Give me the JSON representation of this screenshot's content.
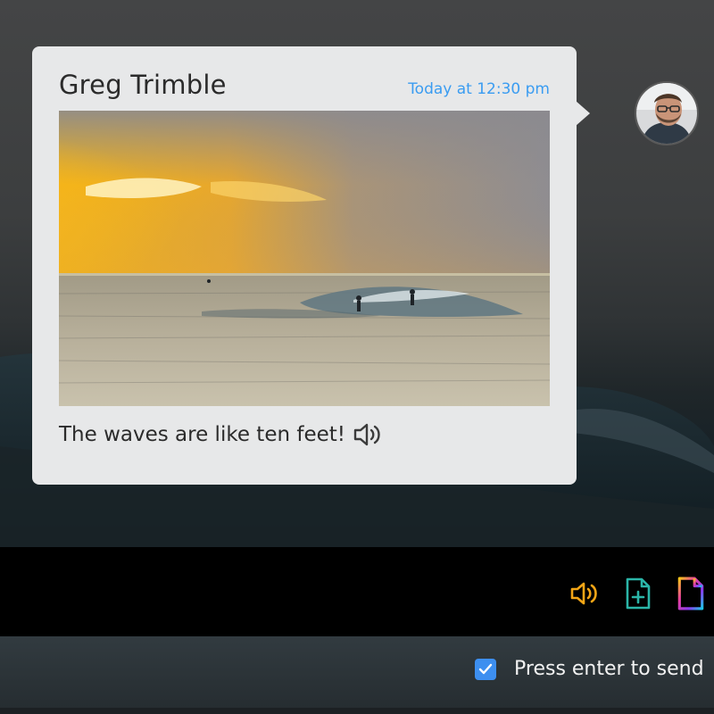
{
  "message": {
    "sender": "Greg Trimble",
    "timestamp": "Today at 12:30 pm",
    "caption": "The waves are like ten feet!",
    "caption_icon": "speaker-icon",
    "photo": "sunset-surf-photo"
  },
  "avatar": {
    "icon": "avatar-photo"
  },
  "toolbar": {
    "items": [
      {
        "name": "audio-message-button",
        "icon": "speaker-icon",
        "color": "#f2a516"
      },
      {
        "name": "add-file-button",
        "icon": "file-plus-icon",
        "color": "#2bb5a8"
      },
      {
        "name": "document-button",
        "icon": "document-icon",
        "color": "#e83ea0"
      }
    ]
  },
  "send_options": {
    "press_enter_label": "Press enter to send",
    "press_enter_checked": true
  },
  "colors": {
    "accent": "#3a9cf1",
    "card_bg": "#e7e8e9",
    "checkbox": "#3d8ff0"
  }
}
